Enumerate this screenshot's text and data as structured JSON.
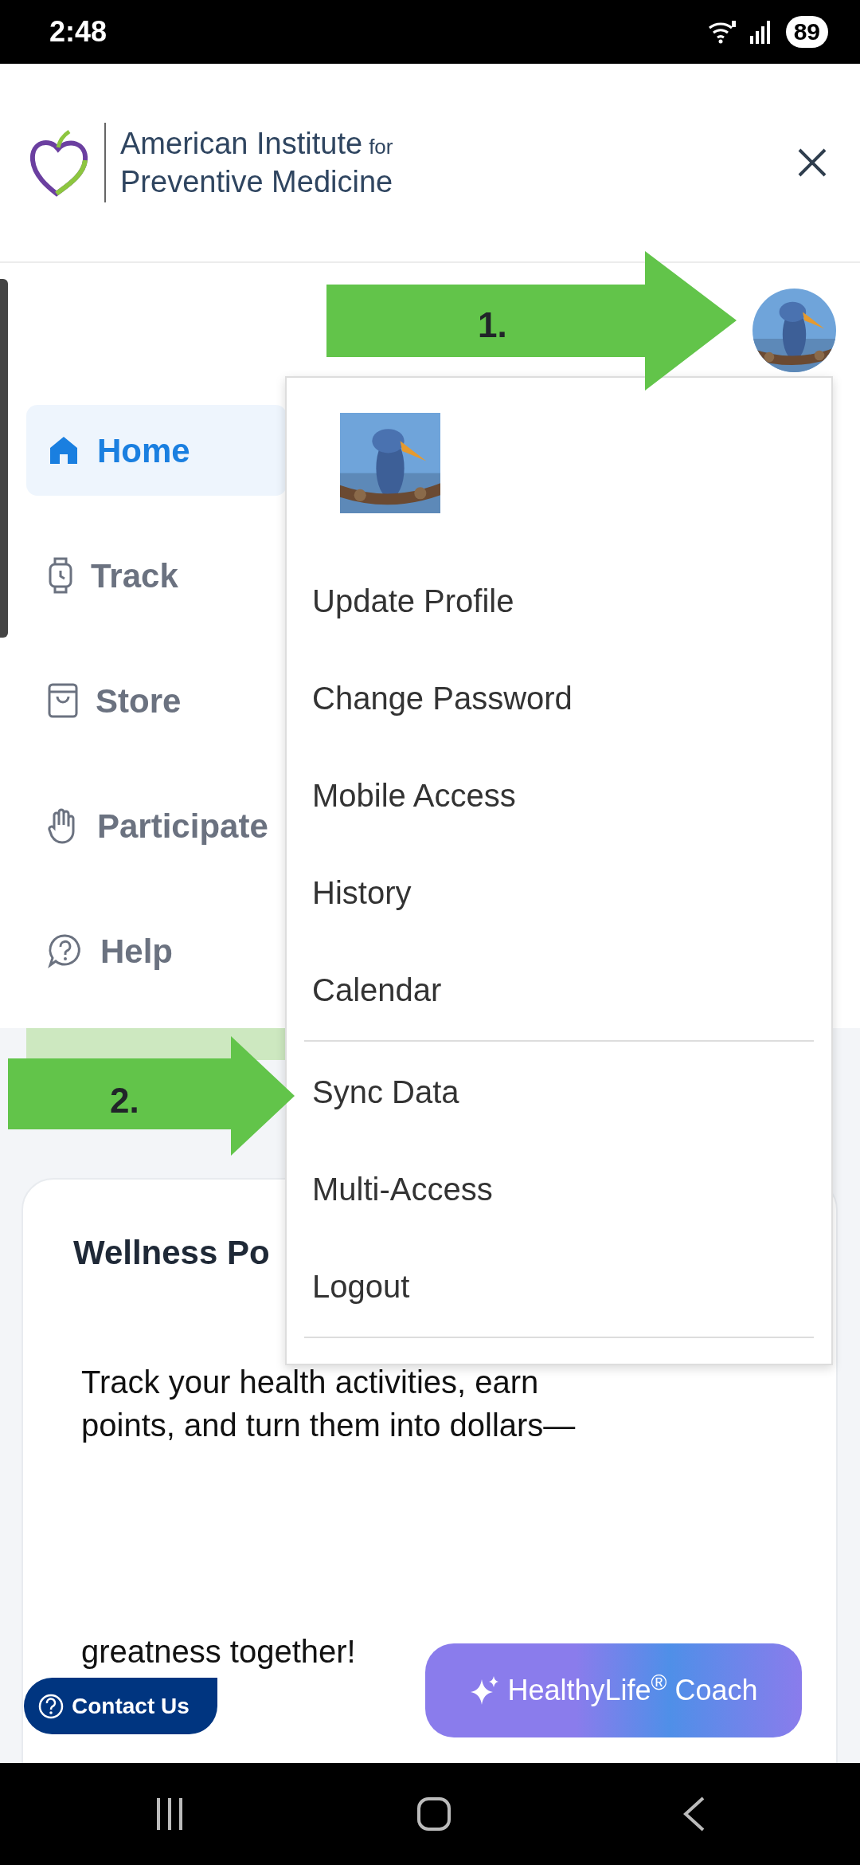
{
  "status_bar": {
    "time": "2:48",
    "battery": "89"
  },
  "header": {
    "logo_line1": "American Institute",
    "logo_for": "for",
    "logo_line2": "Preventive Medicine"
  },
  "sidebar": {
    "items": [
      {
        "label": "Home",
        "selected": true
      },
      {
        "label": "Track",
        "selected": false
      },
      {
        "label": "Store",
        "selected": false
      },
      {
        "label": "Participate",
        "selected": false
      },
      {
        "label": "Help",
        "selected": false
      }
    ]
  },
  "profile_menu": {
    "items": [
      {
        "label": "Update Profile",
        "divider_after": false
      },
      {
        "label": "Change Password",
        "divider_after": false
      },
      {
        "label": "Mobile Access",
        "divider_after": false
      },
      {
        "label": "History",
        "divider_after": false
      },
      {
        "label": "Calendar",
        "divider_after": true
      },
      {
        "label": "Sync Data",
        "divider_after": false
      },
      {
        "label": "Multi-Access",
        "divider_after": false
      },
      {
        "label": "Logout",
        "divider_after": true
      }
    ]
  },
  "card": {
    "title": "Wellness Po",
    "lines": [
      "Track your health activities, earn",
      "points, and turn them into dollars—"
    ],
    "closing": "greatness together!"
  },
  "annotations": [
    {
      "label": "1."
    },
    {
      "label": "2."
    }
  ],
  "contact_button": {
    "label": "Contact Us"
  },
  "coach_button": {
    "label": "HealthyLife$^{®}$ Coach"
  }
}
